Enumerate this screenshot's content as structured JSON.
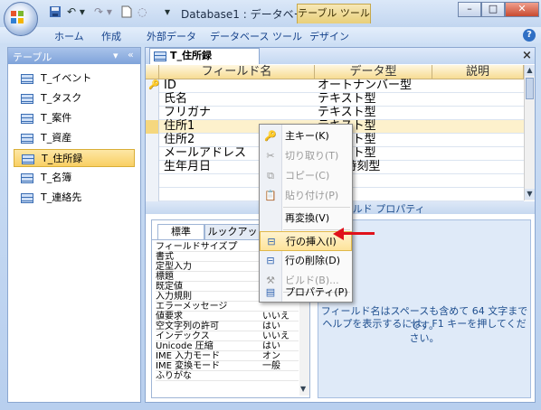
{
  "window": {
    "title": "Database1 : データベース ...",
    "context_tab": "テーブル ツール",
    "controls": {
      "minimize": "–",
      "maximize": "□",
      "close": "✕"
    }
  },
  "quick_access": {
    "save_icon": "save-icon",
    "undo": "↶ ▾",
    "redo": "↷ ▾",
    "dropdown": "▾"
  },
  "ribbon": {
    "tabs": [
      "ホーム",
      "作成",
      "外部データ",
      "データベース ツール",
      "デザイン"
    ],
    "help": "?"
  },
  "nav_pane": {
    "header": "テーブル",
    "items": [
      {
        "label": "T_イベント"
      },
      {
        "label": "T_タスク"
      },
      {
        "label": "T_案件"
      },
      {
        "label": "T_資産"
      },
      {
        "label": "T_住所録",
        "selected": true
      },
      {
        "label": "T_名簿"
      },
      {
        "label": "T_連絡先"
      }
    ]
  },
  "document": {
    "tab_title": "T_住所録",
    "columns": {
      "field_name": "フィールド名",
      "data_type": "データ型",
      "description": "説明"
    },
    "rows": [
      {
        "name": "ID",
        "type": "オートナンバー型",
        "key": true
      },
      {
        "name": "氏名",
        "type": "テキスト型"
      },
      {
        "name": "フリガナ",
        "type": "テキスト型"
      },
      {
        "name": "住所1",
        "type": "テキスト型"
      },
      {
        "name": "住所2",
        "type": "テキスト型"
      },
      {
        "name": "メールアドレス",
        "type": "テキスト型"
      },
      {
        "name": "生年月日",
        "type": "日付/時刻型"
      }
    ],
    "props_header": "フィールド プロパティ",
    "prop_tabs": [
      "標準",
      "ルックアップ"
    ],
    "properties": [
      {
        "label": "フィールドサイズ",
        "value": ""
      },
      {
        "label": "書式",
        "value": ""
      },
      {
        "label": "定型入力",
        "value": ""
      },
      {
        "label": "標題",
        "value": ""
      },
      {
        "label": "既定値",
        "value": ""
      },
      {
        "label": "入力規則",
        "value": ""
      },
      {
        "label": "エラーメッセージ",
        "value": ""
      },
      {
        "label": "値要求",
        "value": "いいえ"
      },
      {
        "label": "空文字列の許可",
        "value": "はい"
      },
      {
        "label": "インデックス",
        "value": "いいえ"
      },
      {
        "label": "Unicode 圧縮",
        "value": "はい"
      },
      {
        "label": "IME 入力モード",
        "value": "オン"
      },
      {
        "label": "IME 変換モード",
        "value": "一般"
      },
      {
        "label": "ふりがな",
        "value": ""
      }
    ],
    "help_text_1": "フィールド名はスペースも含めて 64 文字までです。",
    "help_text_2": "ヘルプを表示するには、F1 キーを押してください。"
  },
  "context_menu": {
    "items": [
      {
        "label": "主キー(K)",
        "icon": "key-icon",
        "enabled": true
      },
      {
        "label": "切り取り(T)",
        "icon": "scissors-icon",
        "enabled": false
      },
      {
        "label": "コピー(C)",
        "icon": "copy-icon",
        "enabled": false
      },
      {
        "label": "貼り付け(P)",
        "icon": "paste-icon",
        "enabled": false
      },
      {
        "label": "再変換(V)",
        "icon": "",
        "enabled": true
      },
      {
        "label": "行の挿入(I)",
        "icon": "insert-row-icon",
        "enabled": true,
        "highlighted": true
      },
      {
        "label": "行の削除(D)",
        "icon": "delete-row-icon",
        "enabled": true
      },
      {
        "label": "ビルド(B)...",
        "icon": "build-icon",
        "enabled": false
      },
      {
        "label": "プロパティ(P)",
        "icon": "properties-icon",
        "enabled": true
      }
    ]
  },
  "annotation": {
    "arrow_color": "#e0111a"
  }
}
